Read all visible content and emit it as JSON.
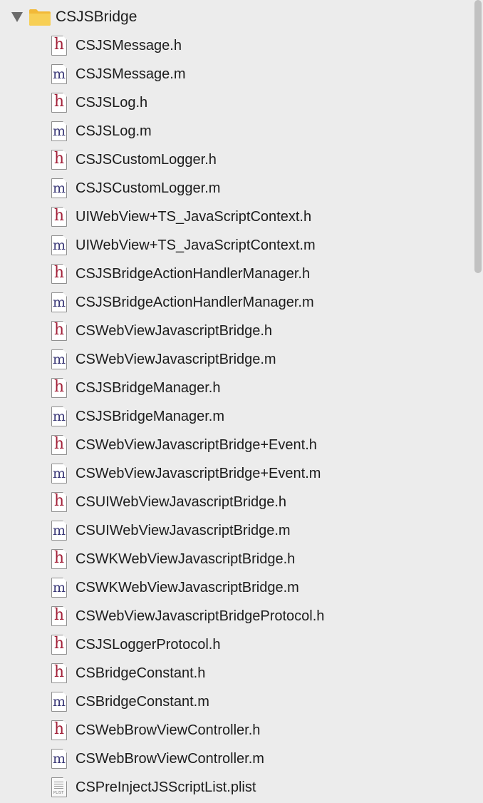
{
  "navigator": {
    "group": {
      "name": "CSJSBridge",
      "expanded": true,
      "icon": "folder-icon",
      "color": "#f7c948"
    },
    "files": [
      {
        "name": "CSJSMessage.h",
        "kind": "h",
        "glyph": "h"
      },
      {
        "name": "CSJSMessage.m",
        "kind": "m",
        "glyph": "m"
      },
      {
        "name": "CSJSLog.h",
        "kind": "h",
        "glyph": "h"
      },
      {
        "name": "CSJSLog.m",
        "kind": "m",
        "glyph": "m"
      },
      {
        "name": "CSJSCustomLogger.h",
        "kind": "h",
        "glyph": "h"
      },
      {
        "name": "CSJSCustomLogger.m",
        "kind": "m",
        "glyph": "m"
      },
      {
        "name": "UIWebView+TS_JavaScriptContext.h",
        "kind": "h",
        "glyph": "h"
      },
      {
        "name": "UIWebView+TS_JavaScriptContext.m",
        "kind": "m",
        "glyph": "m"
      },
      {
        "name": "CSJSBridgeActionHandlerManager.h",
        "kind": "h",
        "glyph": "h"
      },
      {
        "name": "CSJSBridgeActionHandlerManager.m",
        "kind": "m",
        "glyph": "m"
      },
      {
        "name": "CSWebViewJavascriptBridge.h",
        "kind": "h",
        "glyph": "h"
      },
      {
        "name": "CSWebViewJavascriptBridge.m",
        "kind": "m",
        "glyph": "m"
      },
      {
        "name": "CSJSBridgeManager.h",
        "kind": "h",
        "glyph": "h"
      },
      {
        "name": "CSJSBridgeManager.m",
        "kind": "m",
        "glyph": "m"
      },
      {
        "name": "CSWebViewJavascriptBridge+Event.h",
        "kind": "h",
        "glyph": "h"
      },
      {
        "name": "CSWebViewJavascriptBridge+Event.m",
        "kind": "m",
        "glyph": "m"
      },
      {
        "name": "CSUIWebViewJavascriptBridge.h",
        "kind": "h",
        "glyph": "h"
      },
      {
        "name": "CSUIWebViewJavascriptBridge.m",
        "kind": "m",
        "glyph": "m"
      },
      {
        "name": "CSWKWebViewJavascriptBridge.h",
        "kind": "h",
        "glyph": "h"
      },
      {
        "name": "CSWKWebViewJavascriptBridge.m",
        "kind": "m",
        "glyph": "m"
      },
      {
        "name": "CSWebViewJavascriptBridgeProtocol.h",
        "kind": "h",
        "glyph": "h"
      },
      {
        "name": "CSJSLoggerProtocol.h",
        "kind": "h",
        "glyph": "h"
      },
      {
        "name": "CSBridgeConstant.h",
        "kind": "h",
        "glyph": "h"
      },
      {
        "name": "CSBridgeConstant.m",
        "kind": "m",
        "glyph": "m"
      },
      {
        "name": "CSWebBrowViewController.h",
        "kind": "h",
        "glyph": "h"
      },
      {
        "name": "CSWebBrowViewController.m",
        "kind": "m",
        "glyph": "m"
      },
      {
        "name": "CSPreInjectJSScriptList.plist",
        "kind": "plist",
        "glyph": "PLIST"
      }
    ]
  },
  "colors": {
    "background": "#ececec",
    "header_glyph": "#a3223a",
    "impl_glyph": "#3a3877",
    "text": "#1c1c1c",
    "scroll_thumb": "#c1c1c1"
  },
  "scroll": {
    "visible_fraction": 0.34,
    "position_fraction": 0.0
  }
}
